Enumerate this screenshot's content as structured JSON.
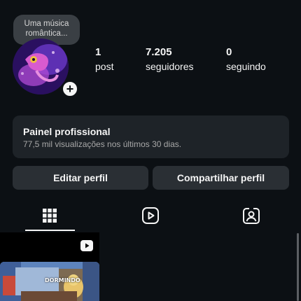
{
  "profile": {
    "note_line1": "Uma música",
    "note_line2": "romântica...",
    "add_icon": "plus-icon"
  },
  "stats": {
    "posts": {
      "value": "1",
      "label": "post"
    },
    "followers": {
      "value": "7.205",
      "label": "seguidores"
    },
    "following": {
      "value": "0",
      "label": "seguindo"
    }
  },
  "pro_panel": {
    "title": "Painel profissional",
    "subtitle": "77,5 mil visualizações nos últimos 30 dias."
  },
  "actions": {
    "edit": "Editar perfil",
    "share": "Compartilhar perfil"
  },
  "tabs": [
    {
      "icon": "grid-icon",
      "active": true
    },
    {
      "icon": "reels-icon",
      "active": false
    },
    {
      "icon": "tagged-person-icon",
      "active": false
    }
  ],
  "post": {
    "overlay_text": "DORMINDO",
    "type_icon": "reels-icon"
  },
  "colors": {
    "background": "#0c1014",
    "panel": "#1e2328",
    "button": "#2a2f34",
    "text": "#f5f5f5",
    "muted": "#a8a8a8"
  }
}
